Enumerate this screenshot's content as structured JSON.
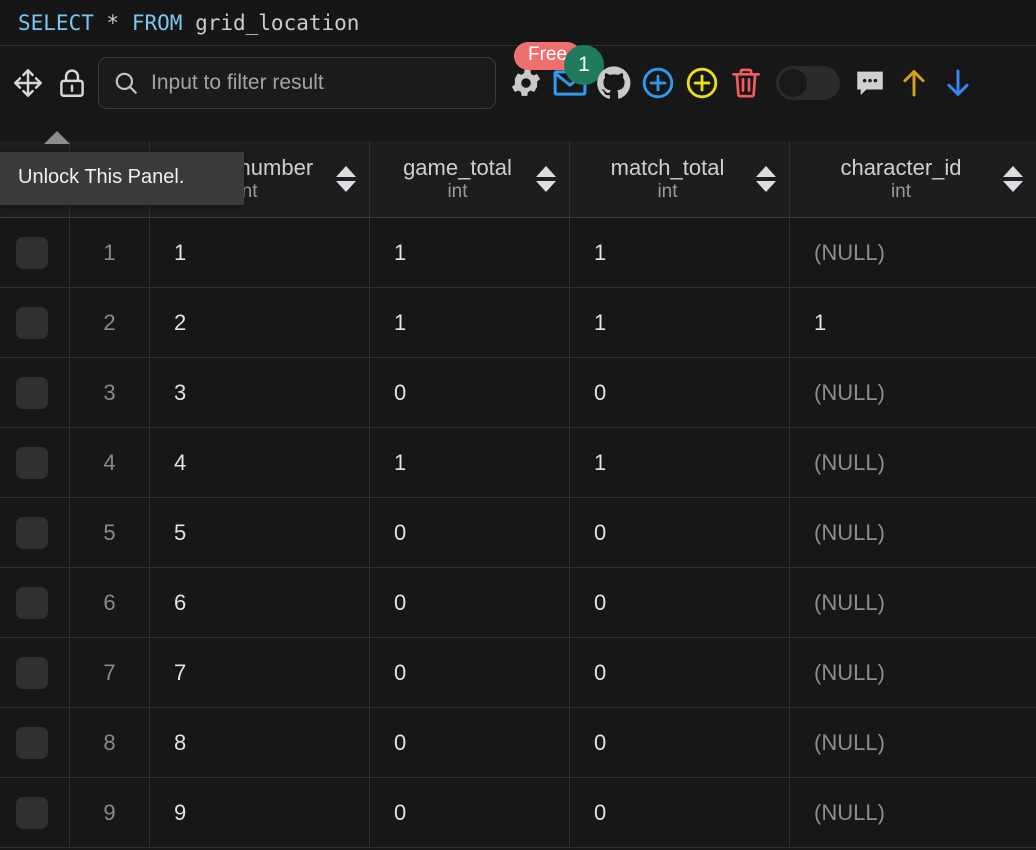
{
  "query": {
    "keyword1": "SELECT",
    "star": "*",
    "keyword2": "FROM",
    "table": "grid_location",
    "full": "SELECT * FROM grid_location"
  },
  "toolbar": {
    "move_handle": "move-handle",
    "lock": "lock",
    "search_placeholder": "Input to filter result",
    "search_value": "",
    "settings": "settings",
    "free_badge": "Free",
    "mail": "mail",
    "mail_count": "1",
    "github": "github",
    "add_row": "add-row",
    "add_column": "add-column",
    "delete": "delete",
    "toggle_state": "off",
    "chat": "chat",
    "upload": "upload",
    "download": "download"
  },
  "tooltip": {
    "text": "Unlock This Panel."
  },
  "table": {
    "columns": [
      {
        "name": "grid_number",
        "type": "int",
        "primary_key": true
      },
      {
        "name": "game_total",
        "type": "int",
        "primary_key": false
      },
      {
        "name": "match_total",
        "type": "int",
        "primary_key": false
      },
      {
        "name": "character_id",
        "type": "int",
        "primary_key": false
      }
    ],
    "null_label": "(NULL)",
    "rows": [
      {
        "n": "1",
        "grid_number": "1",
        "game_total": "1",
        "match_total": "1",
        "character_id": "(NULL)"
      },
      {
        "n": "2",
        "grid_number": "2",
        "game_total": "1",
        "match_total": "1",
        "character_id": "1"
      },
      {
        "n": "3",
        "grid_number": "3",
        "game_total": "0",
        "match_total": "0",
        "character_id": "(NULL)"
      },
      {
        "n": "4",
        "grid_number": "4",
        "game_total": "1",
        "match_total": "1",
        "character_id": "(NULL)"
      },
      {
        "n": "5",
        "grid_number": "5",
        "game_total": "0",
        "match_total": "0",
        "character_id": "(NULL)"
      },
      {
        "n": "6",
        "grid_number": "6",
        "game_total": "0",
        "match_total": "0",
        "character_id": "(NULL)"
      },
      {
        "n": "7",
        "grid_number": "7",
        "game_total": "0",
        "match_total": "0",
        "character_id": "(NULL)"
      },
      {
        "n": "8",
        "grid_number": "8",
        "game_total": "0",
        "match_total": "0",
        "character_id": "(NULL)"
      },
      {
        "n": "9",
        "grid_number": "9",
        "game_total": "0",
        "match_total": "0",
        "character_id": "(NULL)"
      }
    ]
  },
  "colors": {
    "background": "#171717",
    "keyword": "#7cc6f0",
    "free_badge": "#ef6f6f",
    "count_badge": "#1f7a5e",
    "mail": "#2f9af0",
    "add_row": "#2f9af0",
    "add_column": "#e8e117",
    "delete": "#f25c5c",
    "upload": "#d4a017",
    "download": "#3b82f6",
    "pk_star": "#b65050"
  }
}
